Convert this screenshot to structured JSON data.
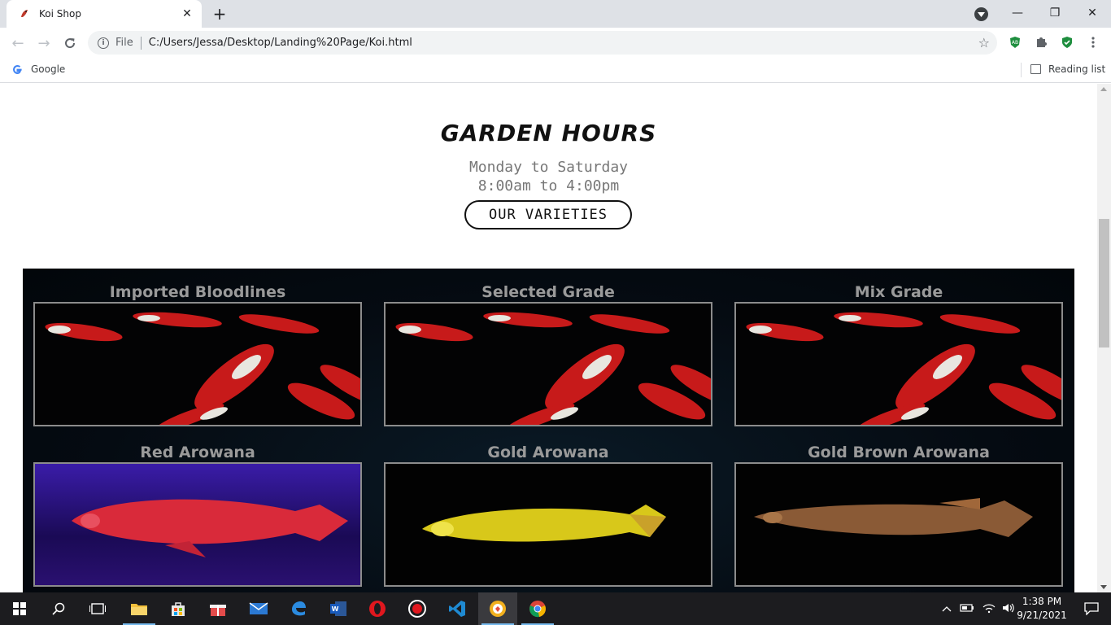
{
  "browser": {
    "tab_title": "Koi Shop",
    "tab_close": "✕",
    "new_tab": "+",
    "scheme_label": "File",
    "url": "C:/Users/Jessa/Desktop/Landing%20Page/Koi.html",
    "bookmark_google": "Google",
    "reading_list": "Reading list",
    "window_controls": {
      "minimize": "—",
      "restore": "❐",
      "close": "✕"
    }
  },
  "page": {
    "hours_title": "GARDEN HOURS",
    "hours_days": "Monday to Saturday",
    "hours_time": "8:00am to 4:00pm",
    "varieties_button": "OUR VARIETIES",
    "cards": [
      {
        "title": "Imported Bloodlines",
        "image": "koi-fish-image"
      },
      {
        "title": "Selected Grade",
        "image": "koi-fish-image"
      },
      {
        "title": "Mix Grade",
        "image": "koi-fish-image"
      },
      {
        "title": "Red Arowana",
        "image": "red-arowana-image"
      },
      {
        "title": "Gold Arowana",
        "image": "gold-arowana-image"
      },
      {
        "title": "Gold Brown Arowana",
        "image": "gold-brown-arowana-image"
      }
    ]
  },
  "taskbar": {
    "time": "1:38 PM",
    "date": "9/21/2021",
    "apps": [
      "start-icon",
      "search-icon",
      "task-view-icon",
      "file-explorer-icon",
      "store-icon",
      "gift-icon",
      "mail-icon",
      "edge-icon",
      "word-icon",
      "opera-icon",
      "record-icon",
      "vscode-icon",
      "brave-icon",
      "chrome-icon"
    ]
  },
  "colors": {
    "gallery_bg": "#050b12",
    "card_title": "#9a9a9a",
    "hours_text": "#777777",
    "taskbar_bg": "#1c1c1f"
  }
}
